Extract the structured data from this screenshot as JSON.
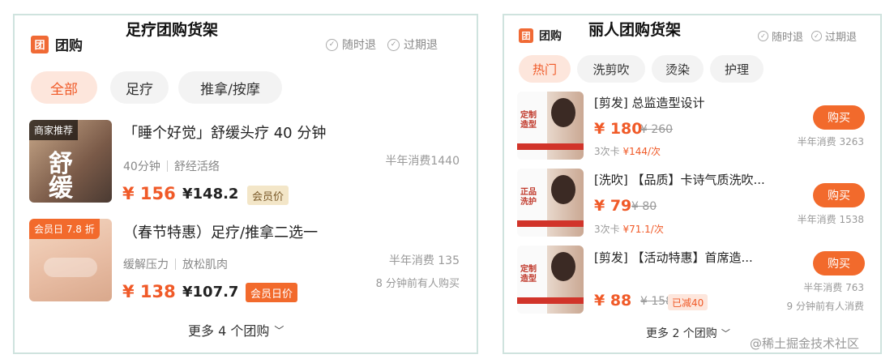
{
  "left": {
    "caption": "足疗团购货架",
    "brand_icon": "团",
    "brand_label": "团购",
    "guarantee": [
      "随时退",
      "过期退"
    ],
    "tabs": [
      "全部",
      "足疗",
      "推拿/按摩"
    ],
    "items": [
      {
        "badge": "商家推荐",
        "title": "「睡个好觉」舒缓头疗 40 分钟",
        "tag1": "40分钟",
        "tag2": "舒经活络",
        "price": "¥ 156",
        "vip_price": "¥148.2",
        "vip_label": "会员价",
        "sold": "半年消费1440",
        "image_text": "舒缓"
      },
      {
        "badge": "会员日 7.8 折",
        "title": "（春节特惠）足疗/推拿二选一",
        "tag1": "缓解压力",
        "tag2": "放松肌肉",
        "price": "¥ 138",
        "vip_price": "¥107.7",
        "vip_label": "会员日价",
        "sold": "半年消费 135",
        "recent": "8 分钟前有人购买"
      }
    ],
    "more": "更多 4 个团购"
  },
  "right": {
    "caption": "丽人团购货架",
    "brand_icon": "团",
    "brand_label": "团购",
    "guarantee": [
      "随时退",
      "过期退"
    ],
    "tabs": [
      "热门",
      "洗剪吹",
      "烫染",
      "护理"
    ],
    "items": [
      {
        "title": "[剪发] 总监造型设计",
        "price": "¥ 180",
        "orig": "¥ 260",
        "sub_prefix": "3次卡 ",
        "sub_value": "¥144/次",
        "buy": "购买",
        "sold": "半年消费 3263",
        "thumb_text": "定制\n造型"
      },
      {
        "title": "[洗吹] 【品质】卡诗气质洗吹...",
        "price": "¥ 79",
        "orig": "¥ 80",
        "sub_prefix": "3次卡 ",
        "sub_value": "¥71.1/次",
        "buy": "购买",
        "sold": "半年消费 1538",
        "thumb_text": "正品\n洗护"
      },
      {
        "title": "[剪发] 【活动特惠】首席造...",
        "price": "¥ 88",
        "orig": "¥ 158",
        "discount": "已减40",
        "buy": "购买",
        "sold": "半年消费 763",
        "recent": "9 分钟前有人消费",
        "thumb_text": "定制\n造型"
      }
    ],
    "more": "更多 2 个团购"
  },
  "watermark": "@稀土掘金技术社区",
  "colors": {
    "accent": "#f05a28",
    "tab_active_bg": "#fde6dc",
    "border": "#cfe3de",
    "vip_bg": "#f3e6c8",
    "vip_day_bg": "#f26a2c"
  }
}
